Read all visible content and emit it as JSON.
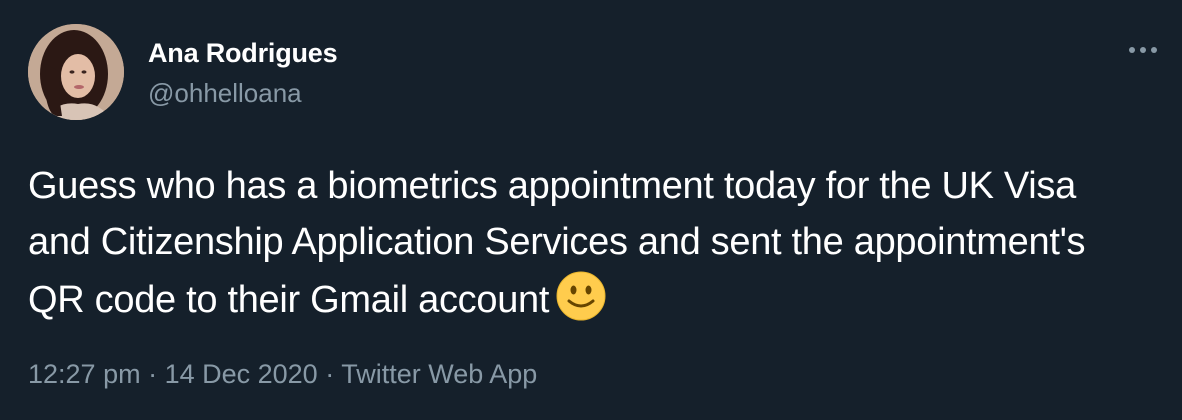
{
  "author": {
    "display_name": "Ana Rodrigues",
    "handle": "@ohhelloana",
    "avatar_icon": "profile-photo"
  },
  "tweet": {
    "text": "Guess who has a biometrics appointment today for the UK Visa and Citizenship Application Services and sent the appointment's QR code to their Gmail account",
    "emoji_icon": "slightly-smiling-face"
  },
  "meta": {
    "time": "12:27 pm",
    "separator": " · ",
    "date": "14 Dec 2020",
    "source": "Twitter Web App"
  },
  "colors": {
    "background": "#15202b",
    "primary_text": "#ffffff",
    "secondary_text": "#8899a6"
  }
}
